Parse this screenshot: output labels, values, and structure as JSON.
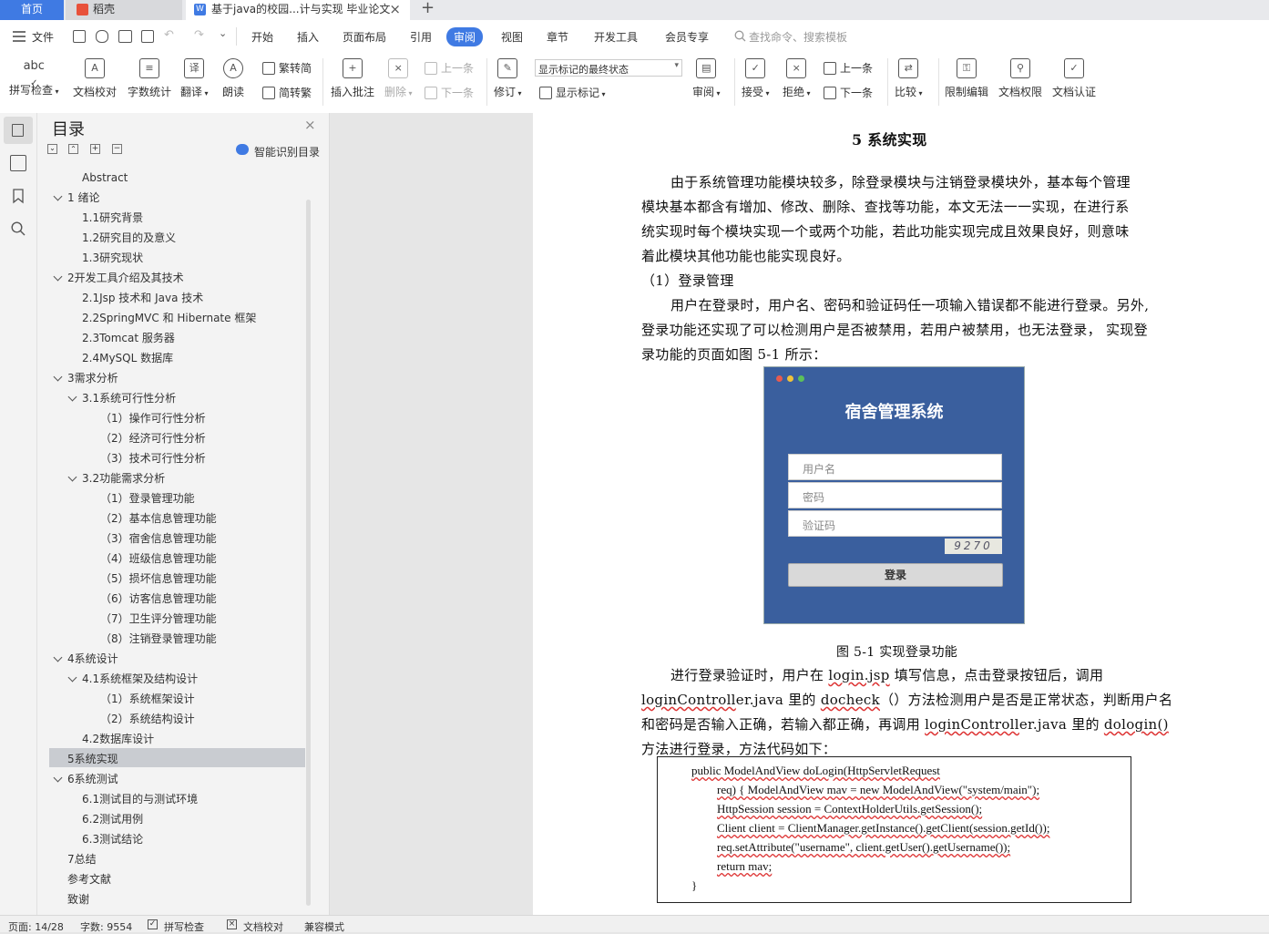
{
  "tabs": {
    "home": "首页",
    "docer": "稻壳",
    "document": "基于java的校园...计与实现 毕业论文",
    "close": "×",
    "add": "+"
  },
  "menu": {
    "file": "文件",
    "items": [
      "开始",
      "插入",
      "页面布局",
      "引用",
      "审阅",
      "视图",
      "章节",
      "开发工具",
      "会员专享"
    ],
    "search_placeholder": "查找命令、搜索模板"
  },
  "ribbon": {
    "spell_check": "拼写检查",
    "doc_proof": "文档校对",
    "word_count": "字数统计",
    "translate": "翻译",
    "read_aloud": "朗读",
    "trad_to_simp": "繁转简",
    "simp_to_trad": "简转繁",
    "insert_comment": "插入批注",
    "delete": "删除",
    "prev_comment": "上一条",
    "next_comment": "下一条",
    "track_changes": "修订",
    "display_state": "显示标记的最终状态",
    "show_markup": "显示标记",
    "review": "审阅",
    "accept": "接受",
    "reject": "拒绝",
    "prev_change": "上一条",
    "next_change": "下一条",
    "compare": "比较",
    "restrict_edit": "限制编辑",
    "doc_permission": "文档权限",
    "doc_certify": "文档认证"
  },
  "toc": {
    "title": "目录",
    "smart_btn": "智能识别目录",
    "items": [
      {
        "text": "Abstract"
      },
      {
        "text": "1 绪论"
      },
      {
        "text": "1.1研究背景"
      },
      {
        "text": "1.2研究目的及意义"
      },
      {
        "text": "1.3研究现状"
      },
      {
        "text": "2开发工具介绍及其技术"
      },
      {
        "text": "2.1Jsp 技术和 Java 技术"
      },
      {
        "text": "2.2SpringMVC 和 Hibernate 框架"
      },
      {
        "text": "2.3Tomcat 服务器"
      },
      {
        "text": "2.4MySQL 数据库"
      },
      {
        "text": "3需求分析"
      },
      {
        "text": "3.1系统可行性分析"
      },
      {
        "text": "（1）操作可行性分析"
      },
      {
        "text": "（2）经济可行性分析"
      },
      {
        "text": "（3）技术可行性分析"
      },
      {
        "text": "3.2功能需求分析"
      },
      {
        "text": "（1）登录管理功能"
      },
      {
        "text": "（2）基本信息管理功能"
      },
      {
        "text": "（3）宿舍信息管理功能"
      },
      {
        "text": "（4）班级信息管理功能"
      },
      {
        "text": "（5）损坏信息管理功能"
      },
      {
        "text": "（6）访客信息管理功能"
      },
      {
        "text": "（7）卫生评分管理功能"
      },
      {
        "text": "（8）注销登录管理功能"
      },
      {
        "text": "4系统设计"
      },
      {
        "text": "4.1系统框架及结构设计"
      },
      {
        "text": "（1）系统框架设计"
      },
      {
        "text": "（2）系统结构设计"
      },
      {
        "text": "4.2数据库设计"
      },
      {
        "text": "5系统实现"
      },
      {
        "text": "6系统测试"
      },
      {
        "text": "6.1测试目的与测试环境"
      },
      {
        "text": "6.2测试用例"
      },
      {
        "text": "6.3测试结论"
      },
      {
        "text": "7总结"
      },
      {
        "text": "参考文献"
      },
      {
        "text": "致谢"
      }
    ]
  },
  "document": {
    "heading": "5  系统实现",
    "para1": [
      "由于系统管理功能模块较多，除登录模块与注销登录模块外，基本每个管理",
      "模块基本都含有增加、修改、删除、查找等功能，本文无法一一实现，在进行系",
      "统实现时每个模块实现一个或两个功能，若此功能实现完成且效果良好，则意味",
      "着此模块其他功能也能实现良好。"
    ],
    "subheading": "（1）登录管理",
    "para2": [
      "用户在登录时，用户名、密码和验证码任一项输入错误都不能进行登录。另外,",
      "登录功能还实现了可以检测用户是否被禁用，若用户被禁用，也无法登录，  实现登",
      "录功能的页面如图  5-1 所示："
    ],
    "figure": {
      "title": "宿舍管理系统",
      "username_ph": "用户名",
      "password_ph": "密码",
      "captcha_ph": "验证码",
      "captcha_code": "9270",
      "login_btn": "登录",
      "caption": "图  5-1  实现登录功能"
    },
    "para3": {
      "l1_a": "进行登录验证时，用户在  ",
      "l1_b": "login.jsp",
      "l1_c": " 填写信息，点击登录按钮后，调用",
      "l2_a": "loginControll",
      "l2_b": "er.java",
      "l2_c": " 里的  ",
      "l2_d": "docheck",
      "l2_e": "（）方法检测用户是否是正常状态，判断用户名",
      "l3_a": "和密码是否输入正确，若输入都正确，再调用  ",
      "l3_b": "loginControll",
      "l3_c": "er.java",
      "l3_d": " 里的  ",
      "l3_e": "dologin()",
      "l4": "方法进行登录，方法代码如下："
    },
    "code": [
      "public ModelAndView doLogin(HttpServletRequest",
      "req) { ModelAndView mav = new ModelAndView(\"system/main\");",
      "HttpSession session = ContextHolderUtils.getSession();",
      "Client client = ClientManager.getInstance().getClient(session.getId());",
      "req.setAttribute(\"username\", client.getUser().getUsername());",
      "return mav;",
      "}"
    ]
  },
  "status": {
    "page": "页面: 14/28",
    "words": "字数: 9554",
    "spell": "拼写检查",
    "proof": "文档校对",
    "compat": "兼容模式"
  }
}
